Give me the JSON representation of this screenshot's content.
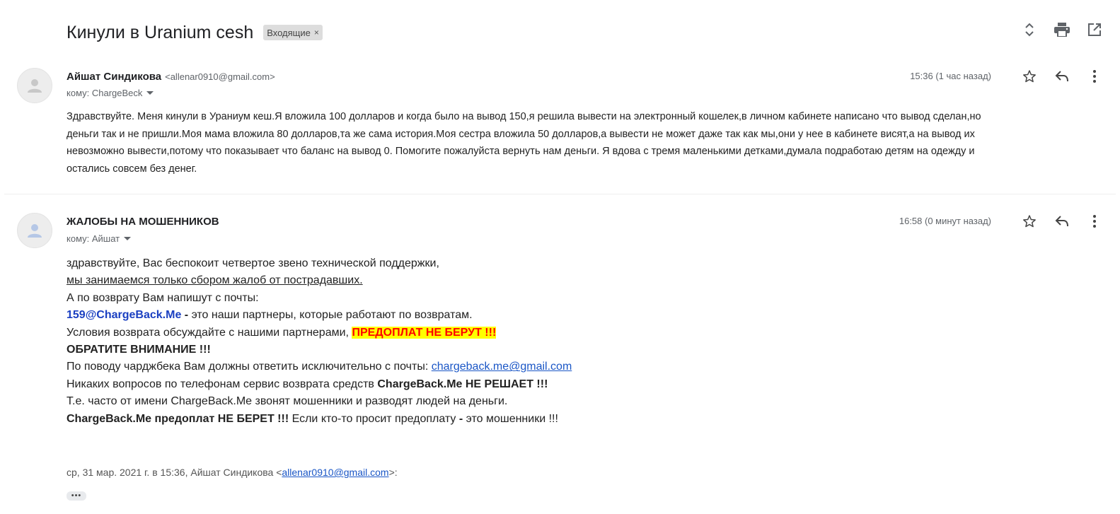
{
  "thread": {
    "subject": "Кинули в Uranium cesh",
    "label": "Входящие",
    "label_remove": "×",
    "actions": {
      "expand_icon": "unfold-icon",
      "print_icon": "print-icon",
      "popout_icon": "open-in-new-window-icon"
    }
  },
  "messages": [
    {
      "sender_name": "Айшат Синдикова",
      "sender_email": "<allenar0910@gmail.com>",
      "to": "кому: ChargeBeck",
      "time": "15:36 (1 час назад)",
      "body_lines": [
        "Здравствуйте. Меня кинули в Ураниум кеш.Я вложила 100 долларов и когда было на вывод 150,я решила вывести на электронный кошелек,в личном кабинете написано что вывод сделан,но",
        "деньги так и не пришли.Моя мама вложила 80 долларов,та же сама история.Моя сестра вложила 50 долларов,а вывести не может даже так как мы,они у нее в кабинете висят,а на вывод их",
        "невозможно вывести,потому что показывает что баланс на вывод 0. Помогите пожалуйста вернуть нам деньги. Я вдова с тремя маленькими детками,думала подработаю детям на одежду и",
        "остались совсем без денег."
      ]
    },
    {
      "sender_name": "ЖАЛОБЫ НА МОШЕННИКОВ",
      "to": "кому: Айшат",
      "time": "16:58 (0 минут назад)",
      "body": {
        "l1": "здравствуйте, Вас беспокоит четвертое звено технической поддержки,",
        "l2": "мы занимаемся только сбором жалоб от пострадавших.",
        "l3": "А по возврату Вам напишут с почты:",
        "l4_email": "159@ChargeBack.Me",
        "l4_dash": " - ",
        "l4_rest": "это наши партнеры, которые работают по возвратам.",
        "l5_text": "Условия возврата обсуждайте с нашими партнерами, ",
        "l5_highlight": "ПРЕДОПЛАТ НЕ БЕРУТ !!!",
        "l6": "ОБРАТИТЕ ВНИМАНИЕ !!!",
        "l7_text": "По поводу чарджбека Вам должны ответить исключительно с почты: ",
        "l7_link": "chargeback.me@gmail.com",
        "l8_text": "Никаких вопросов по телефонам сервис возврата средств ",
        "l8_bold": "ChargeBack.Me НЕ РЕШАЕТ !!!",
        "l9": "Т.е. часто от имени ChargeBack.Me звонят мошенники и разводят людей на деньги.",
        "l10_bold": "ChargeBack.Me предоплат НЕ БЕРЕТ !!!",
        "l10_text": " Если кто-то просит предоплату ",
        "l10_dash": "-",
        "l10_rest": " это мошенники !!!"
      },
      "quote": {
        "prefix": "ср, 31 мар. 2021 г. в 15:36, Айшат Синдикова <",
        "email": "allenar0910@gmail.com",
        "suffix": ">:"
      },
      "show_trimmed": "•••"
    }
  ],
  "colors": {
    "highlight_bg": "#ffff00",
    "highlight_text": "#ff0000",
    "email_blue": "#1a3fc1",
    "link": "#1a56c6"
  }
}
